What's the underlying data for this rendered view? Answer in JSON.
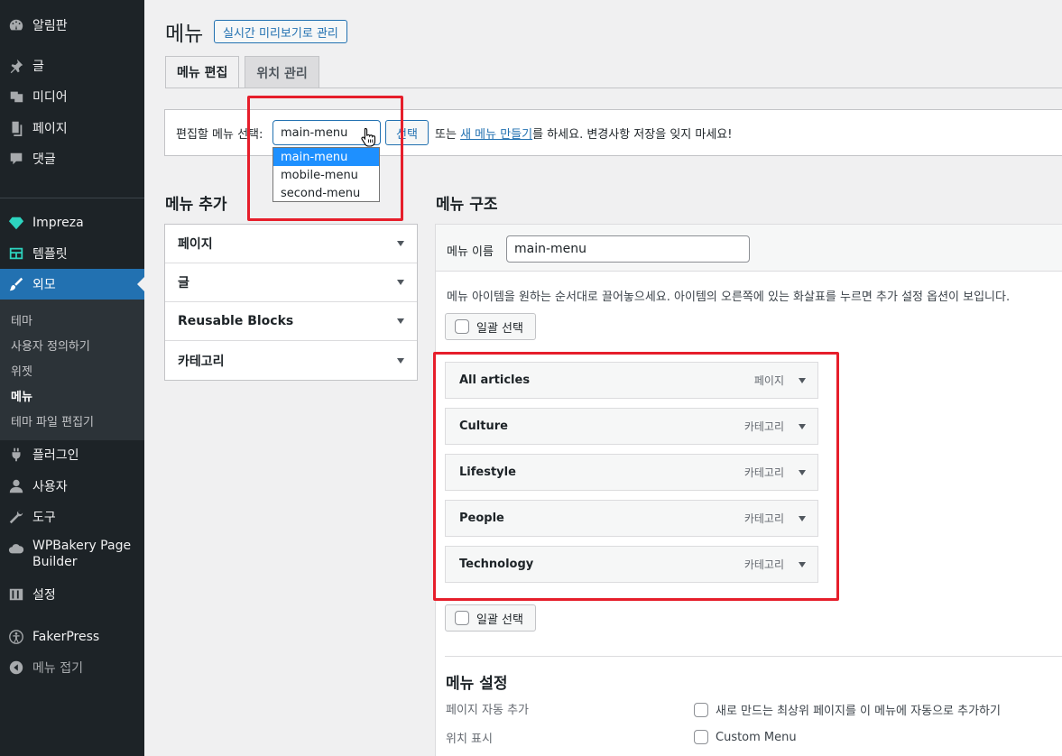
{
  "sidebar": {
    "top_items": [
      {
        "label": "알림판",
        "icon": "dashboard-icon"
      },
      {
        "label": "글",
        "icon": "pin-icon"
      },
      {
        "label": "미디어",
        "icon": "media-icon"
      },
      {
        "label": "페이지",
        "icon": "page-icon"
      },
      {
        "label": "댓글",
        "icon": "comment-icon"
      }
    ],
    "impreza": "Impreza",
    "templates": "템플릿",
    "appearance": "외모",
    "submenu": [
      "테마",
      "사용자 정의하기",
      "위젯",
      "메뉴",
      "테마 파일 편집기"
    ],
    "bottom_items": [
      {
        "label": "플러그인",
        "icon": "plugin-icon"
      },
      {
        "label": "사용자",
        "icon": "user-icon"
      },
      {
        "label": "도구",
        "icon": "wrench-icon"
      },
      {
        "label": "WPBakery Page Builder",
        "icon": "cloud-icon"
      },
      {
        "label": "설정",
        "icon": "settings-icon"
      },
      {
        "label": "FakerPress",
        "icon": "accessibility-icon"
      },
      {
        "label": "메뉴 접기",
        "icon": "collapse-icon"
      }
    ]
  },
  "header": {
    "title": "메뉴",
    "live_preview_button": "실시간 미리보기로 관리"
  },
  "tabs": [
    "메뉴 편집",
    "위치 관리"
  ],
  "manage": {
    "label": "편집할 메뉴 선택:",
    "selected": "main-menu",
    "select_button": "선택",
    "or_text": "또는",
    "create_link": "새 메뉴 만들기",
    "rest_text": "를 하세요. 변경사항 저장을 잊지 마세요!",
    "options": [
      "main-menu",
      "mobile-menu",
      "second-menu"
    ]
  },
  "add_menu": {
    "title": "메뉴 추가",
    "sections": [
      "페이지",
      "글",
      "Reusable Blocks",
      "카테고리"
    ]
  },
  "structure": {
    "title": "메뉴 구조",
    "name_label": "메뉴 이름",
    "name_value": "main-menu",
    "instructions": "메뉴 아이템을 원하는 순서대로 끌어놓으세요. 아이템의 오른쪽에 있는 화살표를 누르면 추가 설정 옵션이 보입니다.",
    "bulk_select": "일괄 선택",
    "items": [
      {
        "title": "All articles",
        "type": "페이지"
      },
      {
        "title": "Culture",
        "type": "카테고리"
      },
      {
        "title": "Lifestyle",
        "type": "카테고리"
      },
      {
        "title": "People",
        "type": "카테고리"
      },
      {
        "title": "Technology",
        "type": "카테고리"
      }
    ]
  },
  "settings": {
    "title": "메뉴 설정",
    "auto_add_label": "페이지 자동 추가",
    "auto_add_option": "새로 만드는 최상위 페이지를 이 메뉴에 자동으로 추가하기",
    "location_label": "위치 표시",
    "location_option": "Custom Menu"
  }
}
